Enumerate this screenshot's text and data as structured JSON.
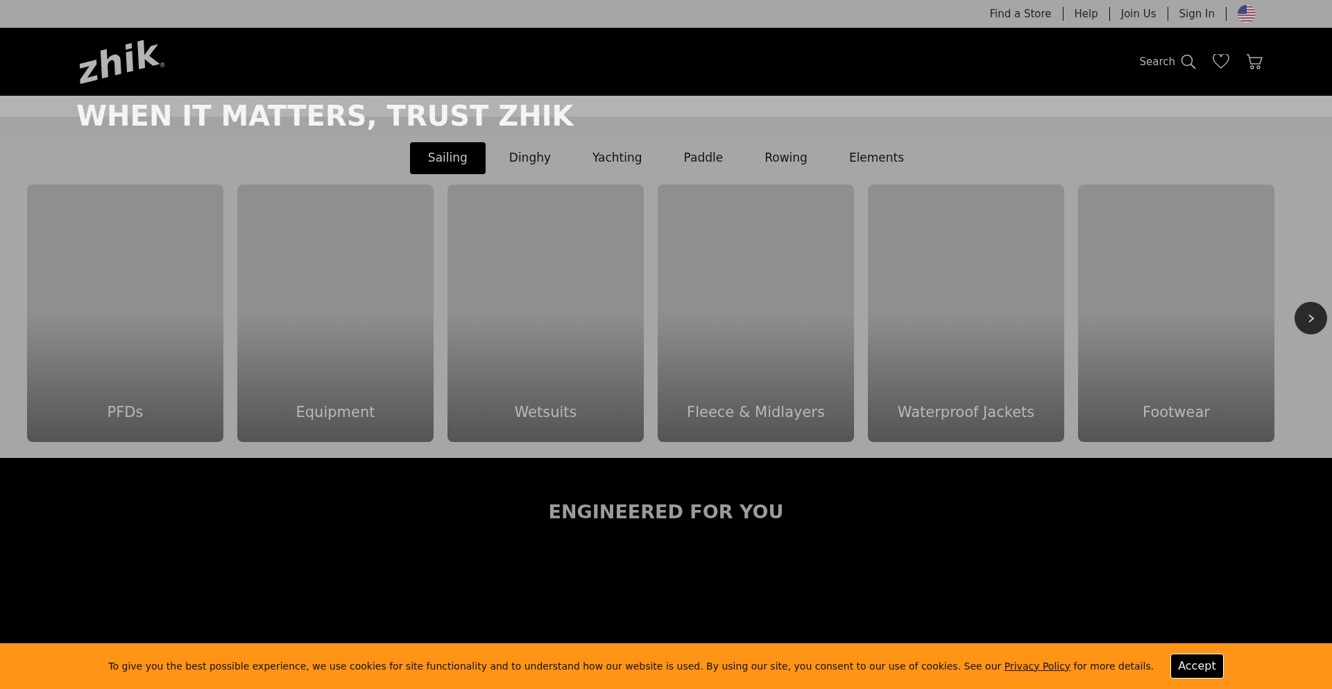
{
  "utility_links": [
    "Find a Store",
    "Help",
    "Join Us",
    "Sign In"
  ],
  "header": {
    "logo": "zhik",
    "logo_mark": "®",
    "search_label": "Search"
  },
  "hero": {
    "title": "WHEN IT MATTERS, TRUST ZHIK"
  },
  "tabs": [
    {
      "label": "Sailing",
      "selected": true
    },
    {
      "label": "Dinghy",
      "selected": false
    },
    {
      "label": "Yachting",
      "selected": false
    },
    {
      "label": "Paddle",
      "selected": false
    },
    {
      "label": "Rowing",
      "selected": false
    },
    {
      "label": "Elements",
      "selected": false
    }
  ],
  "categories": [
    {
      "label": "PFDs"
    },
    {
      "label": "Equipment"
    },
    {
      "label": "Wetsuits"
    },
    {
      "label": "Fleece & Midlayers"
    },
    {
      "label": "Waterproof Jackets"
    },
    {
      "label": "Footwear"
    }
  ],
  "section": {
    "title": "ENGINEERED FOR YOU"
  },
  "cookie_banner": {
    "text_before": "To give you the best possible experience, we use cookies for site functionality and to understand how our website is used. By using our site, you consent to our use of cookies. See our",
    "link": "Privacy Policy",
    "text_after": "for more details.",
    "button": "Accept"
  }
}
